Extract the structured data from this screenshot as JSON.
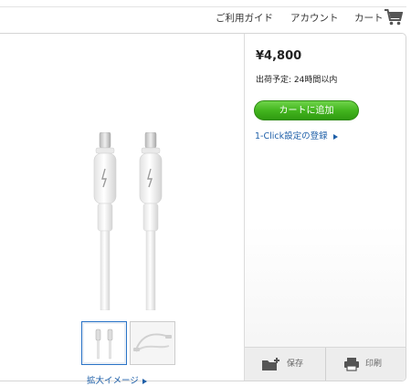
{
  "nav": {
    "guide": "ご利用ガイド",
    "account": "アカウント",
    "cart": "カート",
    "cart_icon": "shopping-cart-icon"
  },
  "product": {
    "price": "¥4,800",
    "shipping": "出荷予定: 24時間以内",
    "add_to_cart": "カートに追加",
    "one_click": "1-Click設定の登録",
    "enlarge": "拡大イメージ",
    "accent_green": "#43b51f",
    "link_blue": "#1e5fa8"
  },
  "actions": {
    "save": "保存",
    "save_icon": "folder-add-icon",
    "print": "印刷",
    "print_icon": "printer-icon"
  }
}
